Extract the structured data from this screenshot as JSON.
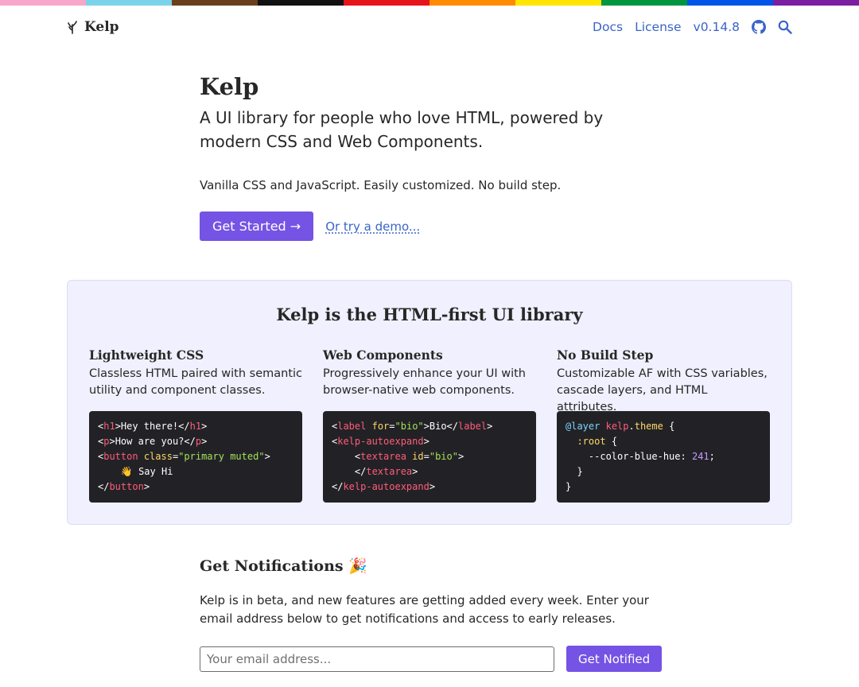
{
  "rainbow_colors": [
    "#f7a8c9",
    "#7bd3ea",
    "#6b3f1d",
    "#111111",
    "#e6141b",
    "#ff8c00",
    "#ffe500",
    "#009640",
    "#0055e8",
    "#7a1fa2"
  ],
  "nav": {
    "brand": "Kelp",
    "brand_icon": "kelp-leaf-icon",
    "links": [
      "Docs",
      "License",
      "v0.14.8"
    ],
    "github_icon": "github-icon",
    "search_icon": "search-icon",
    "link_color": "#3a64c8"
  },
  "hero": {
    "title": "Kelp",
    "tagline": "A UI library for people who love HTML, powered by modern CSS and Web Components.",
    "sub": "Vanilla CSS and JavaScript. Easily customized. No build step.",
    "cta_label": "Get Started →",
    "demo_label": "Or try a demo..."
  },
  "features": {
    "heading": "Kelp is the HTML-first UI library",
    "items": [
      {
        "title": "Lightweight CSS",
        "text": "Classless HTML paired with semantic utility and component classes."
      },
      {
        "title": "Web Components",
        "text": "Progressively enhance your UI with browser-native web components."
      },
      {
        "title": "No Build Step",
        "text": "Customizable AF with CSS variables, cascade layers, and HTML attributes."
      }
    ]
  },
  "notify": {
    "heading": "Get Notifications 🎉",
    "text": "Kelp is in beta, and new features are getting added every week. Enter your email address below to get notifications and access to early releases.",
    "email_placeholder": "Your email address...",
    "button_label": "Get Notified"
  },
  "colors": {
    "accent": "#7553e4",
    "panel_bg": "#f0f0fe",
    "code_bg": "#222226"
  }
}
